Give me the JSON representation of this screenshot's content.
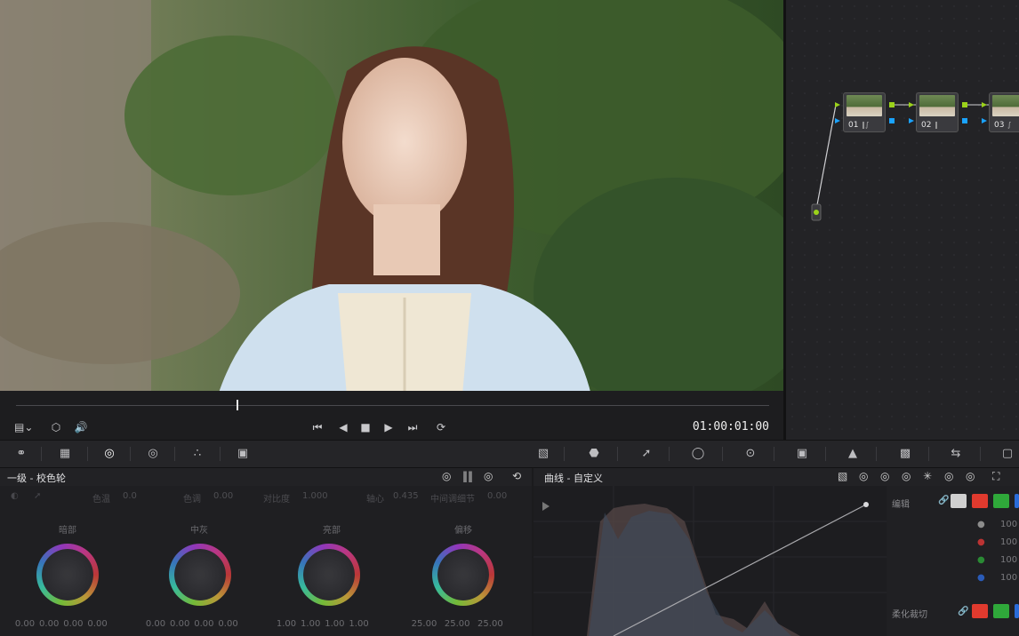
{
  "viewer": {
    "timecode": "01:00:01:00",
    "playhead_fraction": 0.293
  },
  "nodes": [
    {
      "label": "01"
    },
    {
      "label": "02"
    },
    {
      "label": "03"
    }
  ],
  "panels": {
    "wheels_title": "一级 - 校色轮",
    "curves_title": "曲线 - 自定义"
  },
  "wheels_params": {
    "contrast_label": "对比度",
    "contrast": "1.000",
    "pivot_label": "轴心",
    "pivot": "0.435",
    "mid_detail_label": "中间调细节",
    "mid_detail": "0.00",
    "hue_label": "色温",
    "hue": "0.0",
    "tint_label": "色调",
    "tint": "0.00"
  },
  "wheels": [
    {
      "label": "暗部",
      "values": [
        "0.00",
        "0.00",
        "0.00",
        "0.00"
      ]
    },
    {
      "label": "中灰",
      "values": [
        "0.00",
        "0.00",
        "0.00",
        "0.00"
      ]
    },
    {
      "label": "亮部",
      "values": [
        "1.00",
        "1.00",
        "1.00",
        "1.00"
      ]
    },
    {
      "label": "偏移",
      "values": [
        "25.00",
        "25.00",
        "25.00",
        ""
      ]
    }
  ],
  "curves_side": {
    "edit_label": "编辑",
    "soft_clip_label": "柔化裁切",
    "values": [
      "100",
      "100",
      "100",
      "100"
    ]
  },
  "colors": {
    "accent_green": "#9bd21a",
    "accent_blue": "#1aa3ff",
    "red": "#e03a2e",
    "green": "#2fa83a",
    "blue": "#2a6bd8"
  },
  "icons": {
    "transport": [
      "skip-back-icon",
      "play-reverse-icon",
      "stop-icon",
      "play-icon",
      "skip-forward-icon",
      "loop-icon"
    ],
    "viewer_left": [
      "viewer-mode-icon",
      "layers-icon",
      "volume-icon"
    ]
  }
}
